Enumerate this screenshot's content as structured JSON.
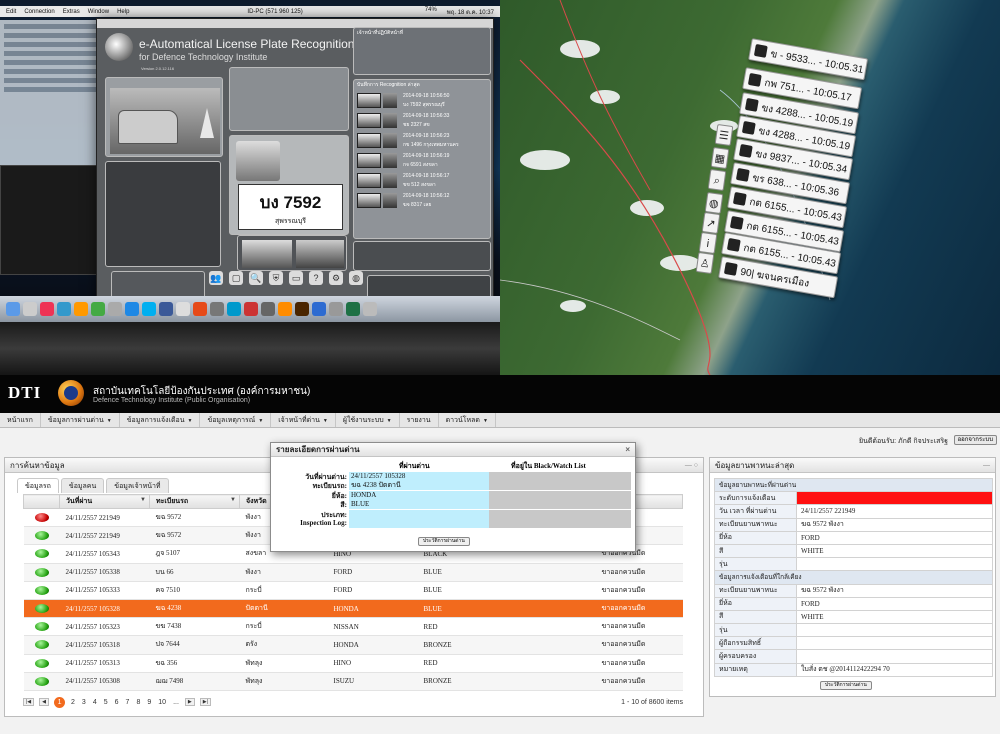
{
  "photo_left": {
    "menubar": {
      "items": [
        "Edit",
        "Connection",
        "Extras",
        "Window",
        "Help"
      ],
      "window_id": "ID-PC (571 960 125)",
      "battery": "74%",
      "clock": "พฤ. 18 ต.ค. 10:37"
    },
    "app": {
      "title": "e-Automatical License Plate Recognition",
      "subtitle": "for Defence Technology Institute",
      "version": "Version 2.0.12.116",
      "plate_number": "บง 7592",
      "plate_province": "สุพรรณบุรี",
      "recognition_header": "บันทึกการ Recognition ล่าสุด",
      "officer_header": "เจ้าหน้าที่ปฏิบัติหน้าที่",
      "recognitions": [
        {
          "time": "2014-09-18 10:56:50",
          "plate": "บง 7592 สุพรรณบุรี"
        },
        {
          "time": "2014-09-18 10:56:33",
          "plate": "ชย 2327 สข"
        },
        {
          "time": "2014-09-18 10:56:23",
          "plate": "กข 1496 กรุงเทพมหานคร"
        },
        {
          "time": "2014-09-18 10:56:19",
          "plate": "กจ 6591 สงขลา"
        },
        {
          "time": "2014-09-18 10:56:17",
          "plate": "ขข 512 สงขลา"
        },
        {
          "time": "2014-09-18 10:56:12",
          "plate": "ฆจ 8317 เลย"
        }
      ]
    }
  },
  "map_cards": [
    "ข - 9533... - 10:05.31",
    "กพ 751... - 10:05.17",
    "ขง 4288... - 10:05.19",
    "ขง 4288... - 10:05.19",
    "ขง 9837... - 10:05.34",
    "ขร 638... - 10:05.36",
    "กต 6155... - 10:05.43",
    "กต 6155... - 10:05.43",
    "กต 6155... - 10:05.43",
    "90| ฆจนครเมือง"
  ],
  "web": {
    "brand": "DTI",
    "org_thai": "สถาบันเทคโนโลยีป้องกันประเทศ (องค์การมหาชน)",
    "org_eng": "Defence Technology Institute (Public Organisation)",
    "nav": [
      {
        "label": "หน้าแรก",
        "caret": false
      },
      {
        "label": "ข้อมูลการผ่านด่าน",
        "caret": true
      },
      {
        "label": "ข้อมูลการแจ้งเตือน",
        "caret": true
      },
      {
        "label": "ข้อมูลเหตุการณ์",
        "caret": true
      },
      {
        "label": "เจ้าหน้าที่ด่าน",
        "caret": true
      },
      {
        "label": "ผู้ใช้งานระบบ",
        "caret": true
      },
      {
        "label": "รายงาน",
        "caret": false
      },
      {
        "label": "ดาวน์โหลด",
        "caret": true
      }
    ],
    "welcome": "ยินดีต้อนรับ: ภักดี กิจประเสริฐ",
    "logout": "ออกจากระบบ",
    "search_panel": {
      "title": "การค้นหาข้อมูล",
      "tabs": [
        "ข้อมูลรถ",
        "ข้อมูลคน",
        "ข้อมูลเจ้าหน้าที่"
      ],
      "columns": [
        "",
        "วันที่ผ่าน",
        "ทะเบียนรถ",
        "จังหวัด",
        "",
        "",
        "",
        ""
      ],
      "rows": [
        {
          "light": "red",
          "date": "24/11/2557 221949",
          "plate": "ฆฉ 9572",
          "province": "พังงา",
          "brand": "",
          "color": "",
          "status": ""
        },
        {
          "light": "green",
          "date": "24/11/2557 221949",
          "plate": "ฆฉ 9572",
          "province": "พังงา",
          "brand": "",
          "color": "",
          "status": ""
        },
        {
          "light": "green",
          "date": "24/11/2557 105343",
          "plate": "ฎจ 5107",
          "province": "สงขลา",
          "brand": "HINO",
          "color": "BLACK",
          "status": "ขาออกควนมีด"
        },
        {
          "light": "green",
          "date": "24/11/2557 105338",
          "plate": "บน 66",
          "province": "พังงา",
          "brand": "FORD",
          "color": "BLUE",
          "status": "ขาออกควนมีด"
        },
        {
          "light": "green",
          "date": "24/11/2557 105333",
          "plate": "คจ 7510",
          "province": "กระบี่",
          "brand": "FORD",
          "color": "BLUE",
          "status": "ขาออกควนมีด"
        },
        {
          "light": "green",
          "date": "24/11/2557 105328",
          "plate": "ฆฉ 4238",
          "province": "ปัตตานี",
          "brand": "HONDA",
          "color": "BLUE",
          "status": "ขาออกควนมีด",
          "selected": true
        },
        {
          "light": "green",
          "date": "24/11/2557 105323",
          "plate": "ขฆ 7438",
          "province": "กระบี่",
          "brand": "NISSAN",
          "color": "RED",
          "status": "ขาออกควนมีด"
        },
        {
          "light": "green",
          "date": "24/11/2557 105318",
          "plate": "ปจ 7644",
          "province": "ตรัง",
          "brand": "HONDA",
          "color": "BRONZE",
          "status": "ขาออกควนมีด"
        },
        {
          "light": "green",
          "date": "24/11/2557 105313",
          "plate": "ขฉ 356",
          "province": "พัทลุง",
          "brand": "HINO",
          "color": "RED",
          "status": "ขาออกควนมีด"
        },
        {
          "light": "green",
          "date": "24/11/2557 105308",
          "plate": "ฌฌ 7498",
          "province": "พัทลุง",
          "brand": "ISUZU",
          "color": "BRONZE",
          "status": "ขาออกควนมีด"
        }
      ],
      "pager": {
        "pages": [
          "1",
          "2",
          "3",
          "4",
          "5",
          "6",
          "7",
          "8",
          "9",
          "10",
          "..."
        ],
        "current": "1",
        "info": "1 - 10 of 8600 items"
      }
    },
    "modal": {
      "title": "รายละเอียดการผ่านด่าน",
      "close": "×",
      "col_pass": "ที่ผ่านด่าน",
      "col_list": "ที่อยู่ใน Black/Watch List",
      "fields": [
        {
          "label": "วันที่ผ่านด่าน:",
          "value": "24/11/2557 105328"
        },
        {
          "label": "ทะเบียนรถ:",
          "value": "ฆฉ 4238 ปัตตานี"
        },
        {
          "label": "ยี่ห้อ:",
          "value": "HONDA"
        },
        {
          "label": "สี:",
          "value": "BLUE"
        },
        {
          "label": "ประเภท:",
          "value": ""
        },
        {
          "label": "Inspection Log:",
          "value": ""
        }
      ],
      "history_button": "ประวัติการผ่านด่าน"
    },
    "detail_panel": {
      "title": "ข้อมูลยานพาหนะล่าสุด",
      "section1": "ข้อมูลยานพาหนะที่ผ่านด่าน",
      "rows1": [
        {
          "key": "ระดับการแจ้งเตือน",
          "value": "",
          "alert": true
        },
        {
          "key": "วัน เวลา ที่ผ่านด่าน",
          "value": "24/11/2557 221949"
        },
        {
          "key": "ทะเบียนยานพาหนะ",
          "value": "ฆฉ 9572 พังงา"
        },
        {
          "key": "ยี่ห้อ",
          "value": "FORD"
        },
        {
          "key": "สี",
          "value": "WHITE"
        },
        {
          "key": "รุ่น",
          "value": ""
        }
      ],
      "section2": "ข้อมูลการแจ้งเตือนที่ใกล้เคียง",
      "rows2": [
        {
          "key": "ทะเบียนยานพาหนะ",
          "value": "ฆฉ 9572 พังงา"
        },
        {
          "key": "ยี่ห้อ",
          "value": "FORD"
        },
        {
          "key": "สี",
          "value": "WHITE"
        },
        {
          "key": "รุ่น",
          "value": ""
        },
        {
          "key": "ผู้ถือกรรมสิทธิ์",
          "value": ""
        },
        {
          "key": "ผู้ครอบครอง",
          "value": ""
        },
        {
          "key": "หมายเหตุ",
          "value": "ใบสั่ง ตช @2014112422294 70"
        }
      ],
      "history_button": "ประวัติการผ่านด่าน"
    }
  }
}
